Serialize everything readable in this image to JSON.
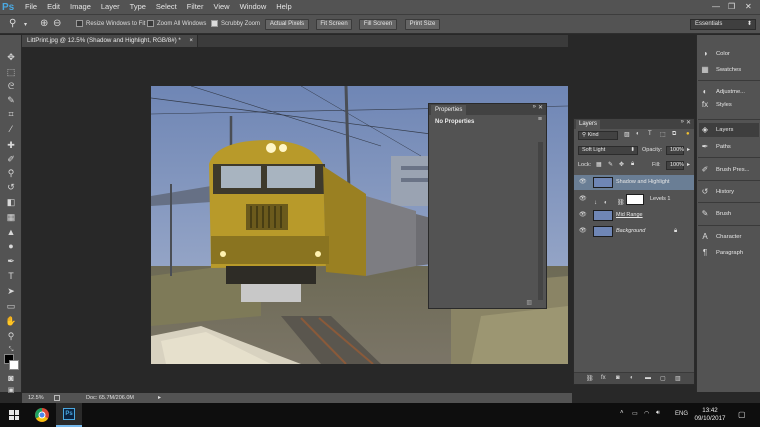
{
  "app": {
    "logo": "Ps"
  },
  "menu": [
    "File",
    "Edit",
    "Image",
    "Layer",
    "Type",
    "Select",
    "Filter",
    "View",
    "Window",
    "Help"
  ],
  "window_controls": {
    "minimize": "—",
    "restore": "❐",
    "close": "✕"
  },
  "options": {
    "resize_windows_label": "Resize Windows to Fit",
    "zoom_all_label": "Zoom All Windows",
    "scrubby_zoom_label": "Scrubby Zoom",
    "actual_pixels": "Actual Pixels",
    "fit_screen": "Fit Screen",
    "fill_screen": "Fill Screen",
    "print_size": "Print Size",
    "workspace": "Essentials"
  },
  "document": {
    "tab_title": "LittPrint.jpg @ 12.5% (Shadow and Highlight, RGB/8#) *",
    "zoom": "12.5%",
    "doc_size": "Doc: 65.7M/206.0M"
  },
  "properties": {
    "tab": "Properties",
    "content": "No Properties"
  },
  "layers": {
    "tab": "Layers",
    "filter_kind": "Kind",
    "blend_mode": "Soft Light",
    "opacity_label": "Opacity:",
    "opacity_value": "100%",
    "lock_label": "Lock:",
    "fill_label": "Fill:",
    "fill_value": "100%",
    "items": [
      {
        "name": "Shadow and Highlight",
        "selected": true
      },
      {
        "name": "Levels 1"
      },
      {
        "name": "Mid Range"
      },
      {
        "name": "Background"
      }
    ]
  },
  "dock": {
    "items": [
      "Color",
      "Swatches",
      "Adjustme...",
      "Styles",
      "Layers",
      "Paths",
      "Brush Pres...",
      "History",
      "Brush",
      "Character",
      "Paragraph"
    ]
  },
  "taskbar": {
    "language": "ENG",
    "time": "13:42",
    "date": "09/10/2017"
  },
  "colors": {
    "ui_panel": "#535353",
    "ui_dark": "#282828",
    "selection": "#6a7e95",
    "ps_blue": "#4aa8e0"
  }
}
